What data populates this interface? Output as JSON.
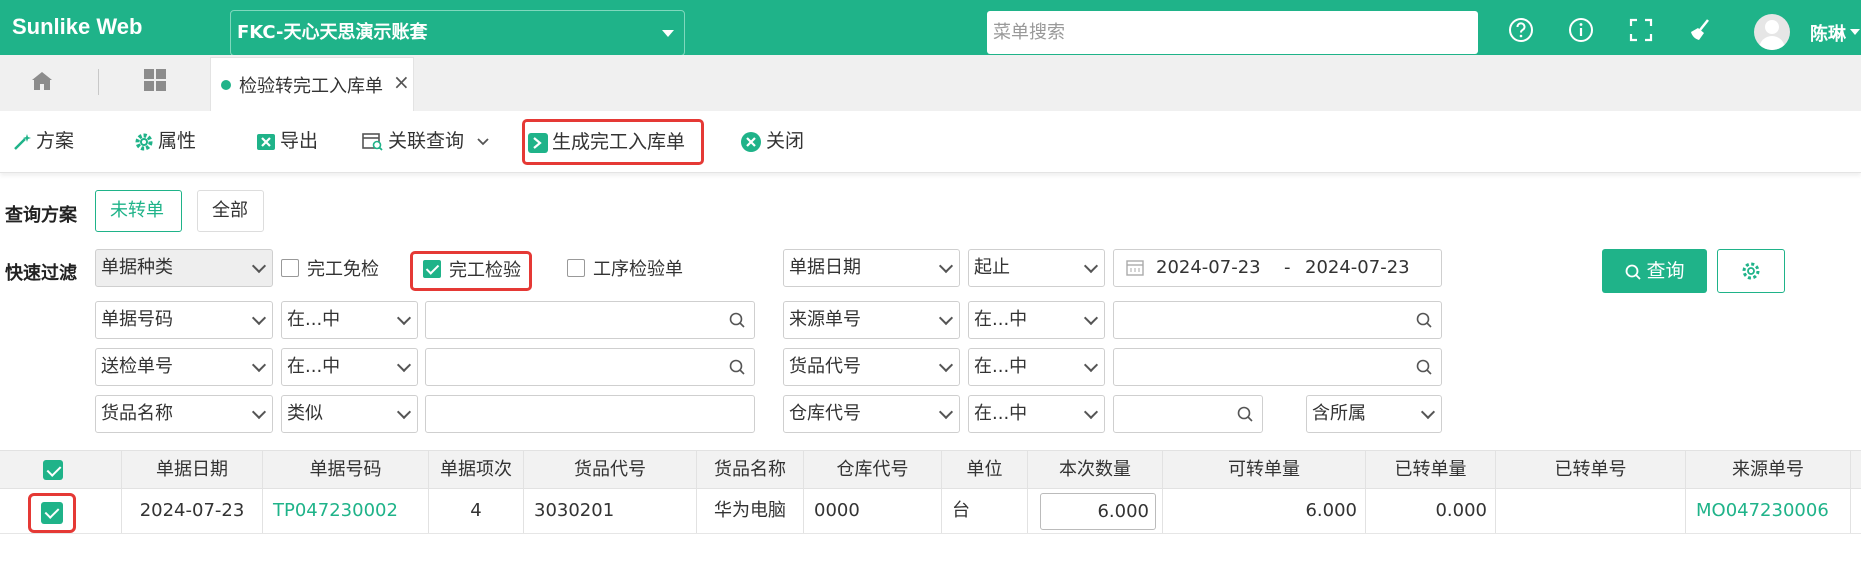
{
  "topbar": {
    "brand": "Sunlike Web",
    "account": "FKC-天心天思演示账套",
    "search_placeholder": "菜单搜索",
    "user": "陈琳",
    "icons": [
      "help-icon",
      "info-icon",
      "fullscreen-icon",
      "broom-icon"
    ]
  },
  "tabs": {
    "active_label": "检验转完工入库单",
    "close": "×"
  },
  "toolbar": {
    "scheme": "方案",
    "props": "属性",
    "export": "导出",
    "related": "关联查询",
    "generate": "生成完工入库单",
    "close": "关闭"
  },
  "query": {
    "scheme_label": "查询方案",
    "not_converted": "未转单",
    "all": "全部",
    "filter_label": "快速过滤",
    "doc_type": "单据种类",
    "chk_exempt": "完工免检",
    "chk_inspect": "完工检验",
    "chk_process": "工序检验单",
    "date_field": "单据日期",
    "date_mode": "起止",
    "date_from": "2024-07-23",
    "date_sep": "-",
    "date_to": "2024-07-23",
    "query_btn": "查询",
    "rows": [
      {
        "field": "单据号码",
        "op": "在...中"
      },
      {
        "field": "送检单号",
        "op": "在...中"
      },
      {
        "field": "货品名称",
        "op": "类似"
      }
    ],
    "rows_right": [
      {
        "field": "来源单号",
        "op": "在...中"
      },
      {
        "field": "货品代号",
        "op": "在...中"
      },
      {
        "field": "仓库代号",
        "op": "在...中",
        "extra": "含所属"
      }
    ]
  },
  "table": {
    "headers": [
      "单据日期",
      "单据号码",
      "单据项次",
      "货品代号",
      "货品名称",
      "仓库代号",
      "单位",
      "本次数量",
      "可转单量",
      "已转单量",
      "已转单号",
      "来源单号"
    ],
    "row": {
      "date": "2024-07-23",
      "doc_no": "TP047230002",
      "item": "4",
      "code": "3030201",
      "name": "华为电脑",
      "warehouse": "0000",
      "unit": "台",
      "qty": "6.000",
      "convertible": "6.000",
      "converted": "0.000",
      "converted_no": "",
      "source_no": "MO047230006"
    }
  },
  "colors": {
    "accent": "#1fb389",
    "highlight": "#e53935"
  }
}
